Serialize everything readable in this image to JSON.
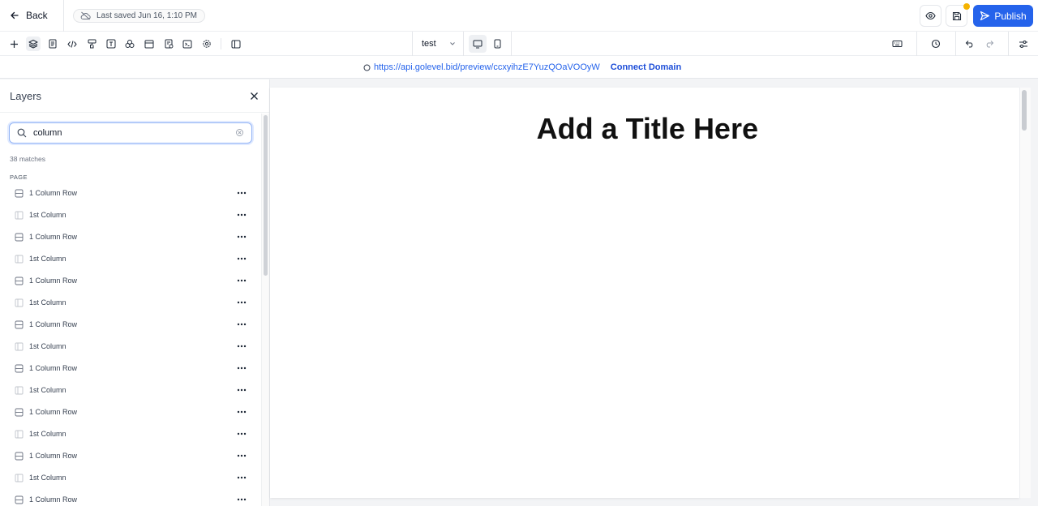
{
  "header": {
    "back_label": "Back",
    "saved_status": "Last saved Jun 16, 1:10 PM",
    "publish_label": "Publish",
    "accent_color": "#2563eb",
    "notification_color": "#f5b300"
  },
  "toolbar": {
    "left_icons": [
      "plus-icon",
      "layers-icon",
      "page-icon",
      "code-icon",
      "paint-icon",
      "text-icon",
      "components-icon",
      "section-icon",
      "form-icon",
      "terminal-icon",
      "settings-gear-icon",
      "split-view-icon"
    ],
    "page_select": "test",
    "devices": [
      "desktop-icon",
      "mobile-icon"
    ],
    "right_icons": [
      "keyboard-icon",
      "history-icon",
      "undo-icon",
      "redo-icon",
      "sliders-icon"
    ]
  },
  "urlbar": {
    "url": "https://api.golevel.bid/preview/ccxyihzE7YuzQOaVOOyW",
    "connect_label": "Connect Domain"
  },
  "layers_panel": {
    "title": "Layers",
    "search_value": "column",
    "matches": "38 matches",
    "section": "PAGE",
    "items": [
      {
        "label": "1 Column Row",
        "type": "row"
      },
      {
        "label": "1st Column",
        "type": "column"
      },
      {
        "label": "1 Column Row",
        "type": "row"
      },
      {
        "label": "1st Column",
        "type": "column"
      },
      {
        "label": "1 Column Row",
        "type": "row"
      },
      {
        "label": "1st Column",
        "type": "column"
      },
      {
        "label": "1 Column Row",
        "type": "row"
      },
      {
        "label": "1st Column",
        "type": "column"
      },
      {
        "label": "1 Column Row",
        "type": "row"
      },
      {
        "label": "1st Column",
        "type": "column"
      },
      {
        "label": "1 Column Row",
        "type": "row"
      },
      {
        "label": "1st Column",
        "type": "column"
      },
      {
        "label": "1 Column Row",
        "type": "row"
      },
      {
        "label": "1st Column",
        "type": "column"
      },
      {
        "label": "1 Column Row",
        "type": "row"
      }
    ]
  },
  "canvas": {
    "title": "Add a Title Here"
  }
}
